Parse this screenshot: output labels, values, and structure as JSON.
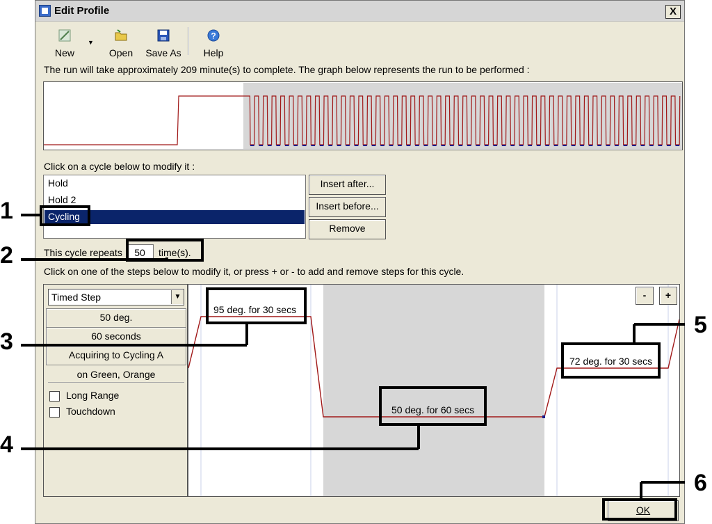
{
  "window": {
    "title": "Edit Profile",
    "close_label": "X"
  },
  "toolbar": {
    "new_label": "New",
    "open_label": "Open",
    "saveas_label": "Save As",
    "help_label": "Help"
  },
  "info_text": "The run will take approximately 209 minute(s) to complete. The graph below represents the run to be performed :",
  "cycles": {
    "prompt": "Click on a cycle below to modify it :",
    "items": [
      "Hold",
      "Hold 2",
      "Cycling"
    ],
    "selected": "Cycling",
    "insert_after_label": "Insert after...",
    "insert_before_label": "Insert before...",
    "remove_label": "Remove"
  },
  "repeat": {
    "label": "This cycle repeats",
    "value": "50",
    "suffix": "time(s)."
  },
  "steps_prompt": "Click on one of the steps below to modify it, or press + or - to add and remove steps for this cycle.",
  "step_panel": {
    "type_value": "Timed Step",
    "temperature": "50 deg.",
    "duration": "60 seconds",
    "acquiring": "Acquiring to Cycling A",
    "channels": "on Green, Orange",
    "long_range_label": "Long Range",
    "touchdown_label": "Touchdown"
  },
  "step_graph": {
    "minus_label": "-",
    "plus_label": "+",
    "steps": [
      {
        "label": "95 deg. for 30 secs"
      },
      {
        "label": "50 deg. for 60 secs"
      },
      {
        "label": "72 deg. for 30 secs"
      }
    ]
  },
  "ok_label": "OK",
  "callouts": [
    "1",
    "2",
    "3",
    "4",
    "5",
    "6"
  ],
  "colors": {
    "selection": "#0a246a",
    "profile_line": "#a01818",
    "cycle_base": "#1a1a8c"
  }
}
